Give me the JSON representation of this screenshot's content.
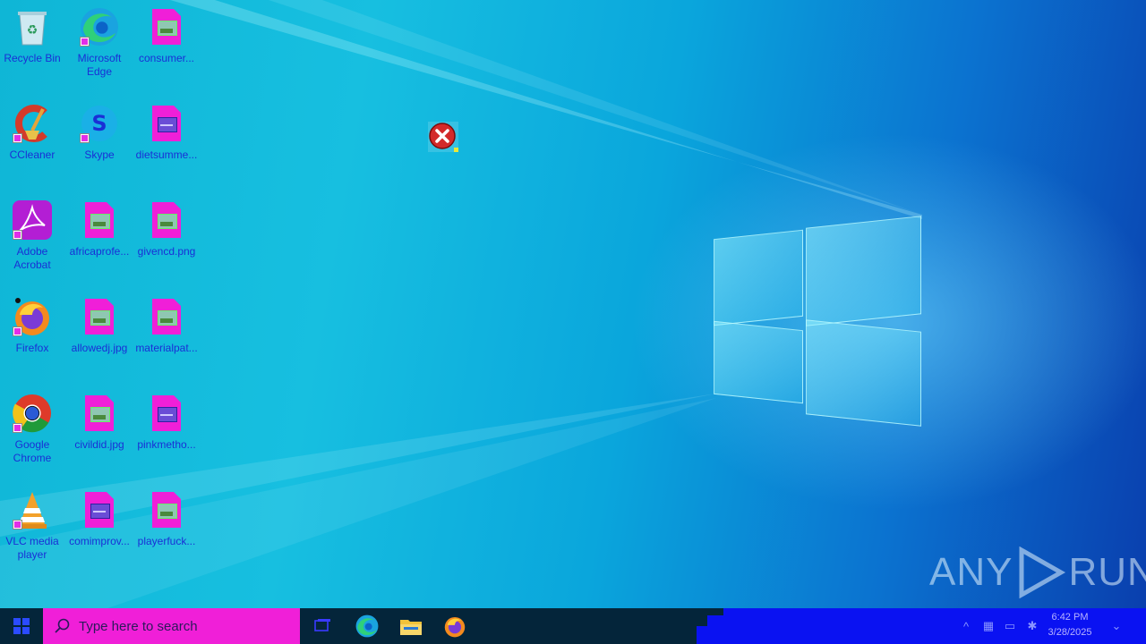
{
  "desktop": {
    "icons": [
      {
        "label": "Recycle Bin",
        "icon": "recycle-bin-icon"
      },
      {
        "label": "Microsoft Edge",
        "icon": "edge-icon"
      },
      {
        "label": "consumer...",
        "icon": "image-file-icon"
      },
      {
        "label": "CCleaner",
        "icon": "ccleaner-icon"
      },
      {
        "label": "Skype",
        "icon": "skype-icon"
      },
      {
        "label": "dietsumme...",
        "icon": "word-doc-icon"
      },
      {
        "label": "Adobe Acrobat",
        "icon": "acrobat-icon"
      },
      {
        "label": "africaprofe...",
        "icon": "image-file-icon"
      },
      {
        "label": "givencd.png",
        "icon": "image-file-icon"
      },
      {
        "label": "Firefox",
        "icon": "firefox-icon"
      },
      {
        "label": "allowedj.jpg",
        "icon": "image-file-icon"
      },
      {
        "label": "materialpat...",
        "icon": "image-file-icon"
      },
      {
        "label": "Google Chrome",
        "icon": "chrome-icon"
      },
      {
        "label": "civildid.jpg",
        "icon": "image-file-icon"
      },
      {
        "label": "pinkmetho...",
        "icon": "word-doc-icon"
      },
      {
        "label": "VLC media player",
        "icon": "vlc-icon"
      },
      {
        "label": "comimprov...",
        "icon": "word-doc-icon"
      },
      {
        "label": "playerfuck...",
        "icon": "image-file-icon"
      }
    ],
    "watermark": {
      "left": "ANY",
      "right": "RUN"
    }
  },
  "taskbar": {
    "search_placeholder": "Type here to search",
    "pinned": [
      "task-view-icon",
      "edge-icon",
      "file-explorer-icon",
      "firefox-icon"
    ],
    "clock": {
      "time": "6:42 PM",
      "date": "3/28/2025"
    }
  },
  "colors": {
    "icon_label": "#1a2fd6",
    "search_box": "#f01fd8",
    "taskbar": "#04253a"
  }
}
